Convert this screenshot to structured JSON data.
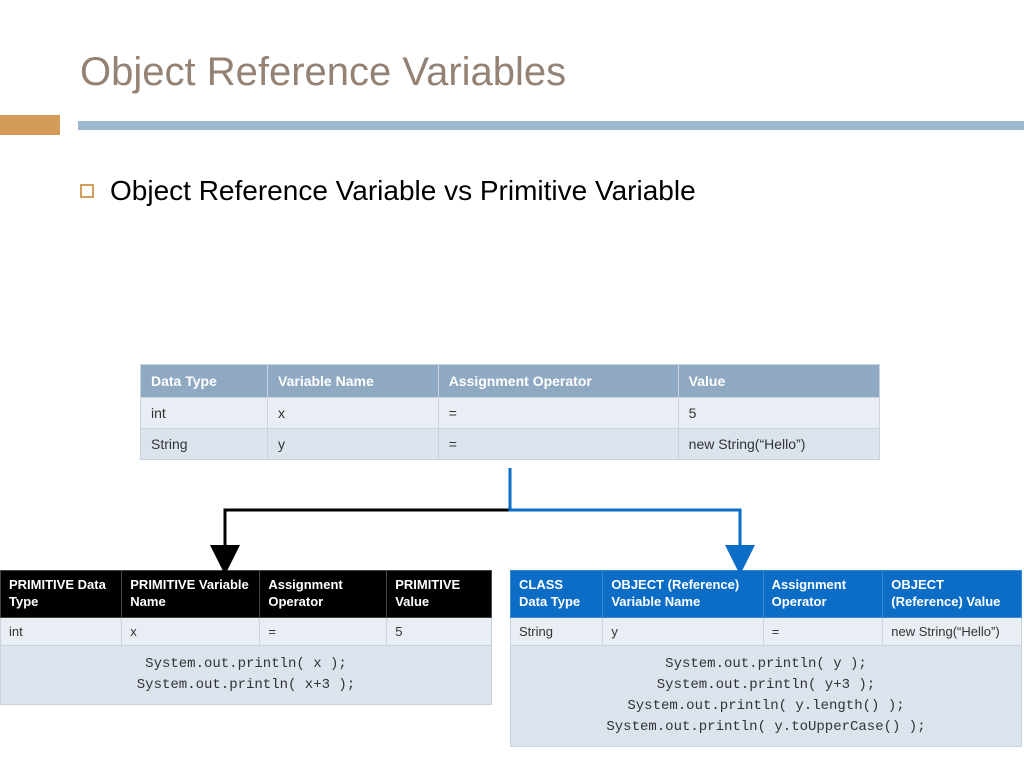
{
  "title": "Object Reference Variables",
  "bullet": "Object Reference Variable vs Primitive Variable",
  "topTable": {
    "headers": [
      "Data Type",
      "Variable Name",
      "Assignment Operator",
      "Value"
    ],
    "rows": [
      [
        "int",
        "x",
        "=",
        "5"
      ],
      [
        "String",
        "y",
        "=",
        "new String(“Hello”)"
      ]
    ]
  },
  "primTable": {
    "headers": [
      "PRIMITIVE Data Type",
      "PRIMITIVE Variable Name",
      "Assignment Operator",
      "PRIMITIVE Value"
    ],
    "row": [
      "int",
      "x",
      "=",
      "5"
    ],
    "code": "System.out.println( x );\nSystem.out.println( x+3 );"
  },
  "objTable": {
    "headers": [
      "CLASS Data Type",
      "OBJECT (Reference) Variable Name",
      "Assignment Operator",
      "OBJECT (Reference) Value"
    ],
    "row": [
      "String",
      "y",
      "=",
      "new String(“Hello”)"
    ],
    "code": "System.out.println( y );\nSystem.out.println( y+3 );\nSystem.out.println( y.length() );\nSystem.out.println( y.toUpperCase() );"
  }
}
